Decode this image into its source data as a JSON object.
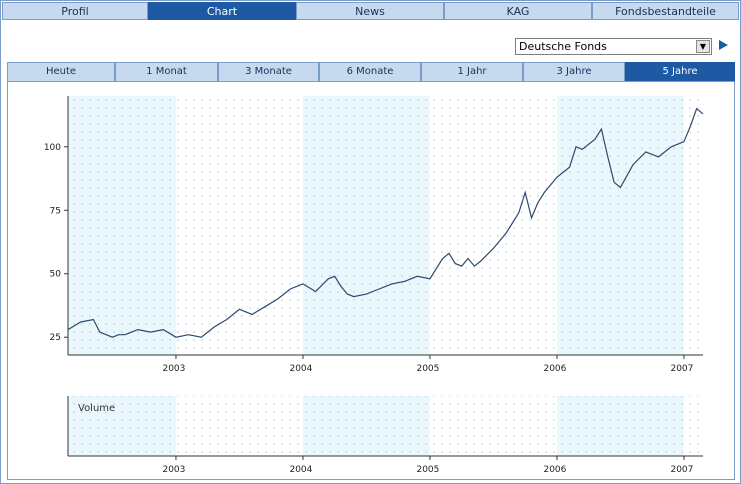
{
  "main_tabs": [
    {
      "label": "Profil",
      "active": false
    },
    {
      "label": "Chart",
      "active": true
    },
    {
      "label": "News",
      "active": false
    },
    {
      "label": "KAG",
      "active": false
    },
    {
      "label": "Fondsbestandteile",
      "active": false
    }
  ],
  "fund_select": {
    "selected": "Deutsche Fonds"
  },
  "range_tabs": [
    {
      "label": "Heute",
      "active": false
    },
    {
      "label": "1 Monat",
      "active": false
    },
    {
      "label": "3 Monate",
      "active": false
    },
    {
      "label": "6 Monate",
      "active": false
    },
    {
      "label": "1 Jahr",
      "active": false
    },
    {
      "label": "3 Jahre",
      "active": false
    },
    {
      "label": "5 Jahre",
      "active": true
    }
  ],
  "colors": {
    "accent": "#1d5aa3",
    "tab_bg": "#c7d9ee",
    "line": "#2b4a6e",
    "band": "#eaf8fd"
  },
  "chart_data": [
    {
      "type": "line",
      "x_ticks": [
        "2003",
        "2004",
        "2005",
        "2006",
        "2007"
      ],
      "y_ticks": [
        25,
        50,
        75,
        100
      ],
      "ylim": [
        18,
        120
      ],
      "xlim": [
        2002.15,
        2007.15
      ],
      "grid": true,
      "series": [
        {
          "x": [
            2002.15,
            2002.25,
            2002.35,
            2002.4,
            2002.45,
            2002.5,
            2002.55,
            2002.6,
            2002.7,
            2002.8,
            2002.9,
            2003.0,
            2003.1,
            2003.2,
            2003.3,
            2003.4,
            2003.5,
            2003.6,
            2003.7,
            2003.8,
            2003.85,
            2003.9,
            2004.0,
            2004.1,
            2004.2,
            2004.25,
            2004.3,
            2004.35,
            2004.4,
            2004.5,
            2004.6,
            2004.7,
            2004.8,
            2004.9,
            2005.0,
            2005.1,
            2005.15,
            2005.2,
            2005.25,
            2005.3,
            2005.35,
            2005.4,
            2005.5,
            2005.6,
            2005.7,
            2005.75,
            2005.8,
            2005.85,
            2005.9,
            2006.0,
            2006.1,
            2006.15,
            2006.2,
            2006.3,
            2006.35,
            2006.4,
            2006.45,
            2006.5,
            2006.6,
            2006.7,
            2006.8,
            2006.9,
            2007.0,
            2007.05,
            2007.1,
            2007.15
          ],
          "values": [
            28,
            31,
            32,
            27,
            26,
            25,
            26,
            26,
            28,
            27,
            28,
            25,
            26,
            25,
            29,
            32,
            36,
            34,
            37,
            40,
            42,
            44,
            46,
            43,
            48,
            49,
            45,
            42,
            41,
            42,
            44,
            46,
            47,
            49,
            48,
            56,
            58,
            54,
            53,
            56,
            53,
            55,
            60,
            66,
            74,
            82,
            72,
            78,
            82,
            88,
            92,
            100,
            99,
            103,
            107,
            96,
            86,
            84,
            93,
            98,
            96,
            100,
            102,
            108,
            115,
            113
          ],
          "line_color": "#2b4a6e"
        }
      ]
    },
    {
      "type": "bar",
      "title": "Volume",
      "x_ticks": [
        "2003",
        "2004",
        "2005",
        "2006",
        "2007"
      ],
      "values": []
    }
  ]
}
